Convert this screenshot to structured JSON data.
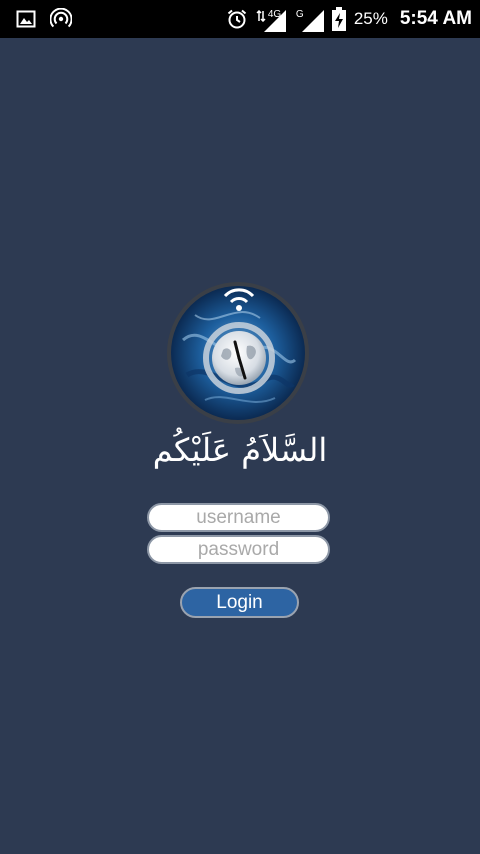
{
  "status_bar": {
    "battery_percent": "25%",
    "time": "5:54 AM",
    "network_primary": "4G",
    "network_secondary": "G",
    "icons": [
      "image-icon",
      "hotspot-icon",
      "alarm-icon",
      "data-arrows-icon",
      "signal-icon",
      "signal-icon",
      "battery-charging-icon"
    ]
  },
  "logo": {
    "description_icon": "clock-wifi-globe-icon"
  },
  "greeting": "السَّلاَمُ عَلَيْكُم",
  "login_form": {
    "username_placeholder": "username",
    "username_value": "",
    "password_placeholder": "password",
    "password_value": "",
    "login_label": "Login"
  },
  "colors": {
    "background": "#2d3a52",
    "status_bar": "#000000",
    "button": "#2d64a3"
  }
}
